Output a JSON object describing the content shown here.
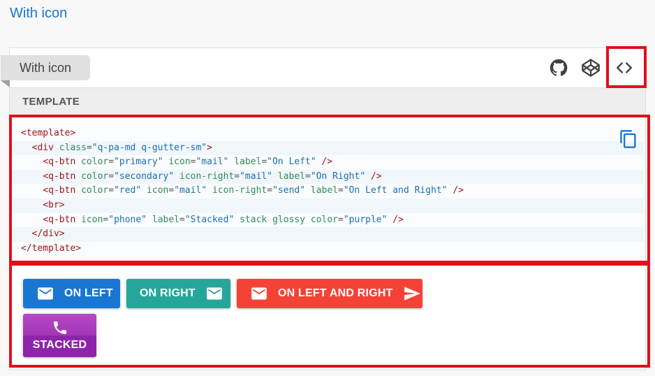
{
  "section": {
    "heading": "With icon"
  },
  "card": {
    "title": "With icon",
    "tools": {
      "github": "github-icon",
      "codepen": "codepen-icon",
      "code": "code-icon"
    },
    "template_header": "TEMPLATE",
    "code_lines": [
      [
        {
          "c": "t",
          "v": "<template>"
        }
      ],
      [
        {
          "c": "p",
          "v": "  "
        },
        {
          "c": "t",
          "v": "<div "
        },
        {
          "c": "a",
          "v": "class"
        },
        {
          "c": "p",
          "v": "="
        },
        {
          "c": "s",
          "v": "\"q-pa-md q-gutter-sm\""
        },
        {
          "c": "t",
          "v": ">"
        }
      ],
      [
        {
          "c": "p",
          "v": "    "
        },
        {
          "c": "t",
          "v": "<q-btn "
        },
        {
          "c": "a",
          "v": "color"
        },
        {
          "c": "p",
          "v": "="
        },
        {
          "c": "s",
          "v": "\"primary\""
        },
        {
          "c": "p",
          "v": " "
        },
        {
          "c": "a",
          "v": "icon"
        },
        {
          "c": "p",
          "v": "="
        },
        {
          "c": "s",
          "v": "\"mail\""
        },
        {
          "c": "p",
          "v": " "
        },
        {
          "c": "a",
          "v": "label"
        },
        {
          "c": "p",
          "v": "="
        },
        {
          "c": "s",
          "v": "\"On Left\""
        },
        {
          "c": "t",
          "v": " />"
        }
      ],
      [
        {
          "c": "p",
          "v": "    "
        },
        {
          "c": "t",
          "v": "<q-btn "
        },
        {
          "c": "a",
          "v": "color"
        },
        {
          "c": "p",
          "v": "="
        },
        {
          "c": "s",
          "v": "\"secondary\""
        },
        {
          "c": "p",
          "v": " "
        },
        {
          "c": "a",
          "v": "icon-right"
        },
        {
          "c": "p",
          "v": "="
        },
        {
          "c": "s",
          "v": "\"mail\""
        },
        {
          "c": "p",
          "v": " "
        },
        {
          "c": "a",
          "v": "label"
        },
        {
          "c": "p",
          "v": "="
        },
        {
          "c": "s",
          "v": "\"On Right\""
        },
        {
          "c": "t",
          "v": " />"
        }
      ],
      [
        {
          "c": "p",
          "v": "    "
        },
        {
          "c": "t",
          "v": "<q-btn "
        },
        {
          "c": "a",
          "v": "color"
        },
        {
          "c": "p",
          "v": "="
        },
        {
          "c": "s",
          "v": "\"red\""
        },
        {
          "c": "p",
          "v": " "
        },
        {
          "c": "a",
          "v": "icon"
        },
        {
          "c": "p",
          "v": "="
        },
        {
          "c": "s",
          "v": "\"mail\""
        },
        {
          "c": "p",
          "v": " "
        },
        {
          "c": "a",
          "v": "icon-right"
        },
        {
          "c": "p",
          "v": "="
        },
        {
          "c": "s",
          "v": "\"send\""
        },
        {
          "c": "p",
          "v": " "
        },
        {
          "c": "a",
          "v": "label"
        },
        {
          "c": "p",
          "v": "="
        },
        {
          "c": "s",
          "v": "\"On Left and Right\""
        },
        {
          "c": "t",
          "v": " />"
        }
      ],
      [
        {
          "c": "p",
          "v": "    "
        },
        {
          "c": "t",
          "v": "<br>"
        }
      ],
      [
        {
          "c": "p",
          "v": "    "
        },
        {
          "c": "t",
          "v": "<q-btn "
        },
        {
          "c": "a",
          "v": "icon"
        },
        {
          "c": "p",
          "v": "="
        },
        {
          "c": "s",
          "v": "\"phone\""
        },
        {
          "c": "p",
          "v": " "
        },
        {
          "c": "a",
          "v": "label"
        },
        {
          "c": "p",
          "v": "="
        },
        {
          "c": "s",
          "v": "\"Stacked\""
        },
        {
          "c": "p",
          "v": " "
        },
        {
          "c": "a",
          "v": "stack glossy"
        },
        {
          "c": "p",
          "v": " "
        },
        {
          "c": "a",
          "v": "color"
        },
        {
          "c": "p",
          "v": "="
        },
        {
          "c": "s",
          "v": "\"purple\""
        },
        {
          "c": "t",
          "v": " />"
        }
      ],
      [
        {
          "c": "p",
          "v": "  "
        },
        {
          "c": "t",
          "v": "</div>"
        }
      ],
      [
        {
          "c": "t",
          "v": "</template>"
        }
      ]
    ],
    "buttons": {
      "on_left": {
        "label": "ON LEFT",
        "icon": "mail-icon",
        "color": "#1976d2"
      },
      "on_right": {
        "label": "ON RIGHT",
        "icon_right": "mail-icon",
        "color": "#26a69a"
      },
      "on_left_right": {
        "label": "ON LEFT AND RIGHT",
        "icon": "mail-icon",
        "icon_right": "send-icon",
        "color": "#f44336"
      },
      "stacked": {
        "label": "STACKED",
        "icon": "phone-icon",
        "color": "#8e24aa"
      }
    }
  },
  "colors": {
    "heading": "#1976d2",
    "highlight_frame": "#e0101a"
  }
}
